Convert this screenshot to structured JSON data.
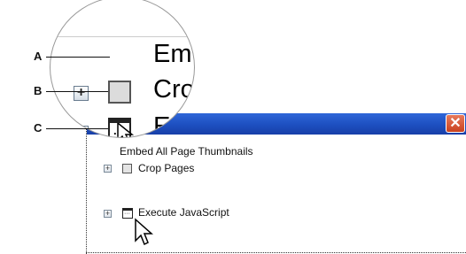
{
  "callouts": [
    "A",
    "B",
    "C"
  ],
  "window": {
    "close_glyph": "✕"
  },
  "tree": {
    "items": [
      {
        "label": "Embed All Page Thumbnails"
      },
      {
        "label": "Crop Pages"
      },
      {
        "label": "Execute JavaScript"
      }
    ]
  },
  "magnified": {
    "row_a": "Em",
    "row_b": "Cro",
    "row_c": "Ex",
    "js_glyph": "..."
  },
  "colors": {
    "titlebar": "#2f66d8",
    "close_button": "#c9411f"
  }
}
